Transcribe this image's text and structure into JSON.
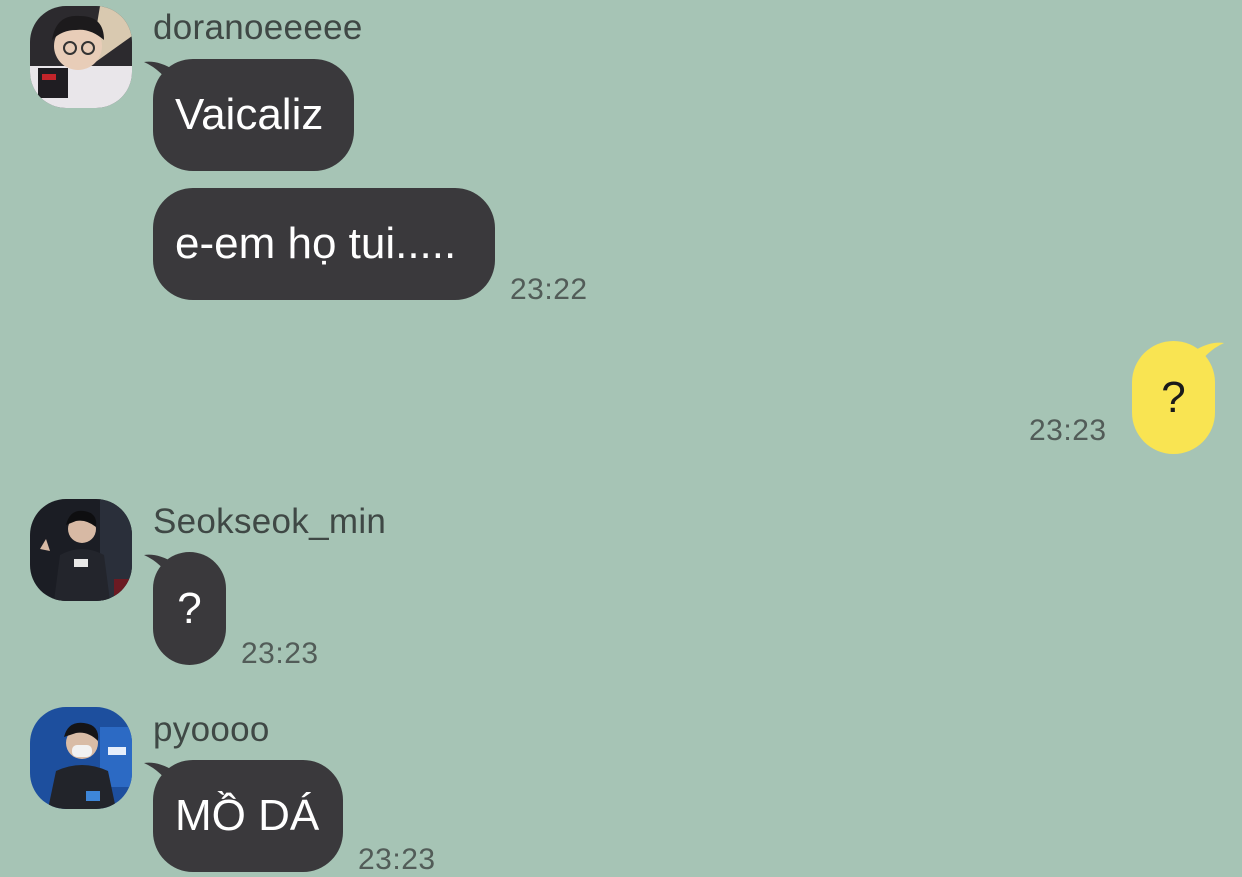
{
  "chat": {
    "messages": [
      {
        "sender": "doranoeeeee",
        "avatar_icon": "avatar-doranoeeeee",
        "bubbles": [
          "Vaicaliz",
          "e-em họ tui....."
        ],
        "time": "23:22"
      },
      {
        "sender": "me",
        "bubbles": [
          "?"
        ],
        "time": "23:23"
      },
      {
        "sender": "Seokseok_min",
        "avatar_icon": "avatar-seokseok-min",
        "bubbles": [
          "?"
        ],
        "time": "23:23"
      },
      {
        "sender": "pyoooo",
        "avatar_icon": "avatar-pyoooo",
        "bubbles": [
          "MỒ DÁ"
        ],
        "time": "23:23"
      }
    ]
  },
  "colors": {
    "background": "#a6c4b5",
    "incoming_bubble": "#3a393c",
    "outgoing_bubble": "#f9e452"
  }
}
